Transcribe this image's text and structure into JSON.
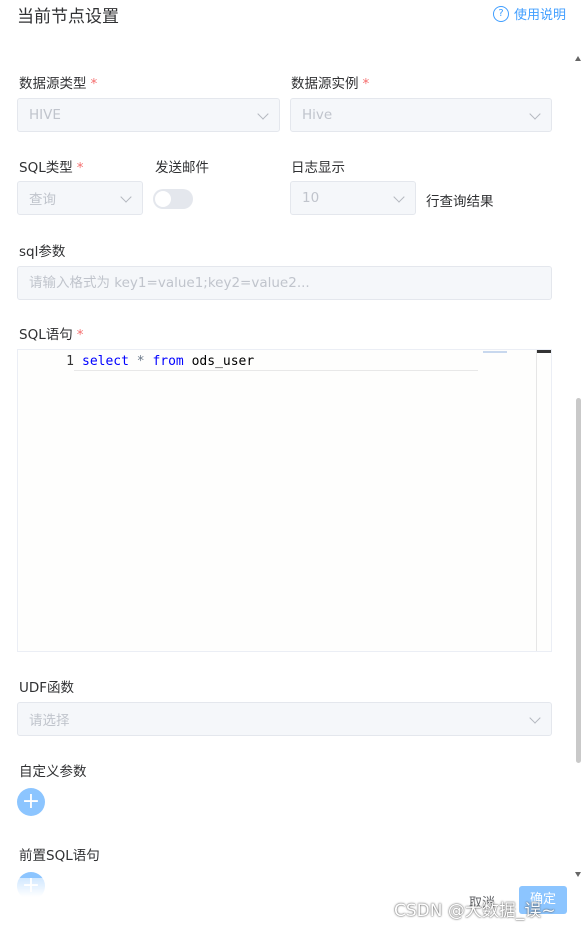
{
  "header": {
    "title": "当前节点设置",
    "help_label": "使用说明",
    "help_icon": "question-circle-icon",
    "help_icon_glyph": "?"
  },
  "fields": {
    "datasource_type": {
      "label": "数据源类型",
      "required_mark": "*",
      "value": "HIVE"
    },
    "datasource_instance": {
      "label": "数据源实例",
      "required_mark": "*",
      "value": "Hive"
    },
    "sql_type": {
      "label": "SQL类型",
      "required_mark": "*",
      "value": "查询"
    },
    "send_email": {
      "label": "发送邮件",
      "enabled": false
    },
    "log_display": {
      "label": "日志显示",
      "value": "10",
      "suffix": "行查询结果"
    },
    "sql_params": {
      "label": "sql参数",
      "placeholder": "请输入格式为 key1=value1;key2=value2..."
    },
    "sql_statement": {
      "label": "SQL语句",
      "required_mark": "*",
      "line_number": "1",
      "code": {
        "kw1": "select",
        "star": " * ",
        "kw2": "from",
        "rest": " ods_user"
      }
    },
    "udf": {
      "label": "UDF函数",
      "placeholder": "请选择"
    },
    "custom_params": {
      "label": "自定义参数",
      "add_glyph": "+"
    },
    "pre_sql": {
      "label": "前置SQL语句",
      "add_glyph": "+"
    }
  },
  "footer": {
    "cancel_label": "取消",
    "ok_label": "确定"
  },
  "watermark": "CSDN @大数据_误~",
  "colors": {
    "accent": "#409eff",
    "required": "#f56c6c",
    "add_button": "#8cc5ff",
    "disabled_bg": "#f5f7fa"
  }
}
